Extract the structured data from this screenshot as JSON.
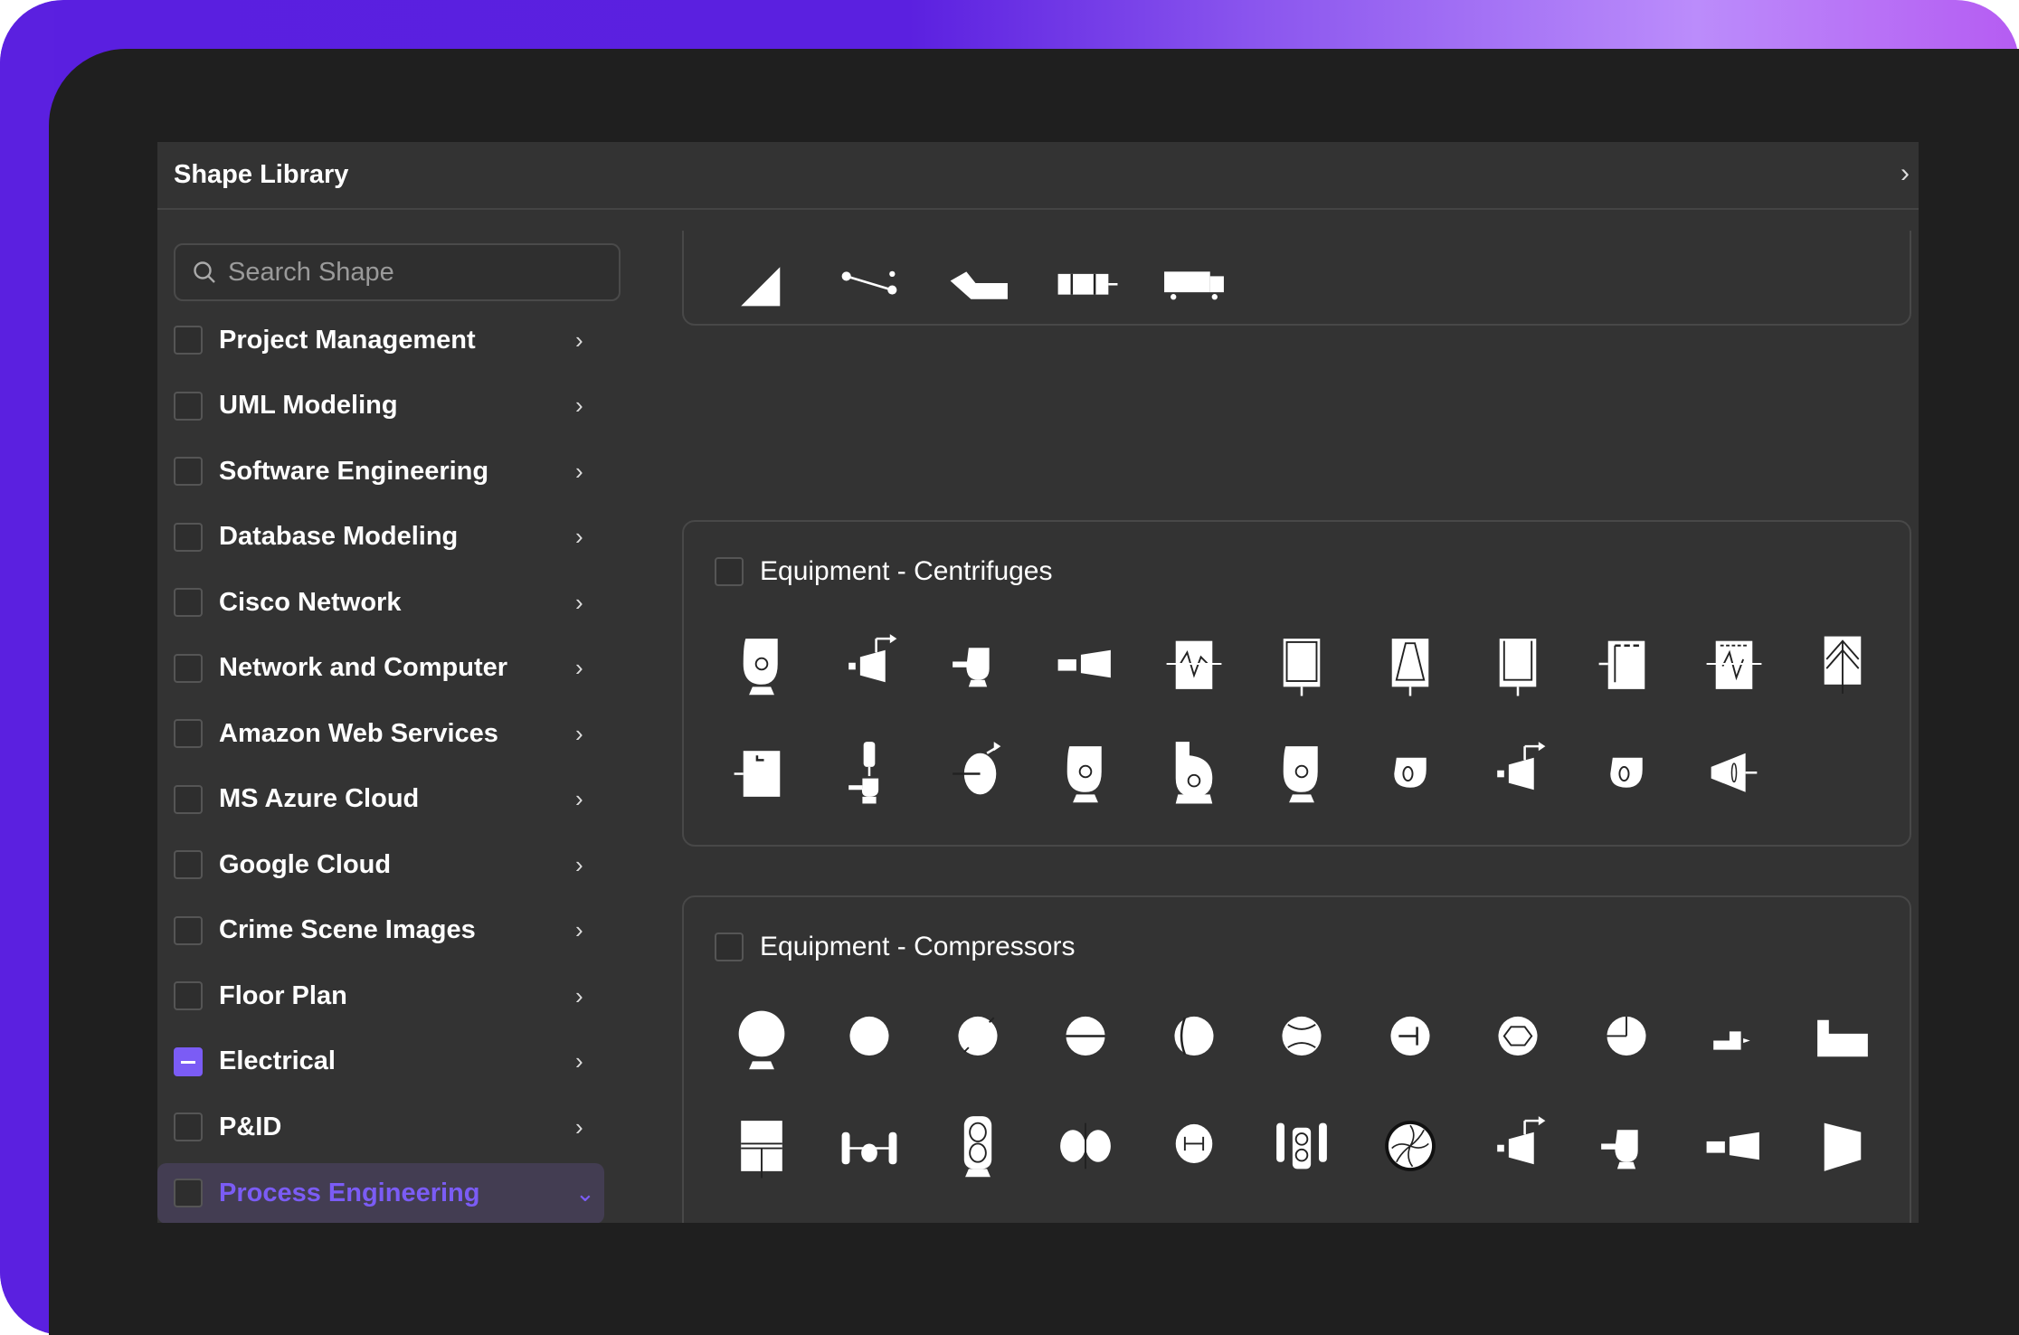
{
  "dialog": {
    "title": "Shape Library",
    "collapse_icon": "chevron-right-icon"
  },
  "search": {
    "placeholder": "Search Shape",
    "value": ""
  },
  "accent": "#7b5cf5",
  "categories": [
    {
      "label": "Project Management",
      "state": "unchecked",
      "expanded": false
    },
    {
      "label": "UML Modeling",
      "state": "unchecked",
      "expanded": false
    },
    {
      "label": "Software Engineering",
      "state": "unchecked",
      "expanded": false
    },
    {
      "label": "Database Modeling",
      "state": "unchecked",
      "expanded": false
    },
    {
      "label": "Cisco Network",
      "state": "unchecked",
      "expanded": false
    },
    {
      "label": "Network and Computer",
      "state": "unchecked",
      "expanded": false
    },
    {
      "label": "Amazon Web Services",
      "state": "unchecked",
      "expanded": false
    },
    {
      "label": "MS Azure Cloud",
      "state": "unchecked",
      "expanded": false
    },
    {
      "label": "Google Cloud",
      "state": "unchecked",
      "expanded": false
    },
    {
      "label": "Crime Scene Images",
      "state": "unchecked",
      "expanded": false
    },
    {
      "label": "Floor Plan",
      "state": "unchecked",
      "expanded": false
    },
    {
      "label": "Electrical",
      "state": "partial",
      "expanded": false
    },
    {
      "label": "P&ID",
      "state": "unchecked",
      "expanded": false
    },
    {
      "label": "Process Engineering",
      "state": "unchecked",
      "expanded": true
    }
  ],
  "sections": [
    {
      "title": "",
      "icons": [
        "wedge",
        "line-nodes",
        "hopper",
        "inline-block",
        "truck"
      ]
    },
    {
      "title": "Equipment - Centrifuges",
      "icons": [
        "blower-stand",
        "turbine-arrow",
        "blower-small",
        "inline-turbine",
        "vessel-wave",
        "vessel-plain",
        "vessel-cone",
        "vessel-side",
        "vessel-dashed",
        "vessel-dashed-wave",
        "vessel-chevron",
        "vessel-tag",
        "stacked-pump",
        "disc-arrow",
        "blower-stand",
        "blower-tall",
        "blower-stand",
        "volute",
        "turbine-arrow",
        "volute",
        "cone-fan"
      ]
    },
    {
      "title": "Equipment - Compressors",
      "icons": [
        "ellipse-stand",
        "ellipse",
        "ellipse-hatched",
        "ellipse-line",
        "ellipse-arc",
        "ellipse-arcs",
        "ellipse-tee",
        "ellipse-hex",
        "ellipse-cross",
        "step-block",
        "notch-block",
        "split-box",
        "twin-posts",
        "tower-stand",
        "twin-ellipse",
        "ellipse-h",
        "posts-tower",
        "fan-wheel",
        "turbine-arrow",
        "blower-small",
        "inline-turbine",
        "trapezoid",
        "turbine-arrow",
        "skid",
        "tank-box",
        "ellipse-wave",
        "ellipse-ring"
      ]
    }
  ]
}
